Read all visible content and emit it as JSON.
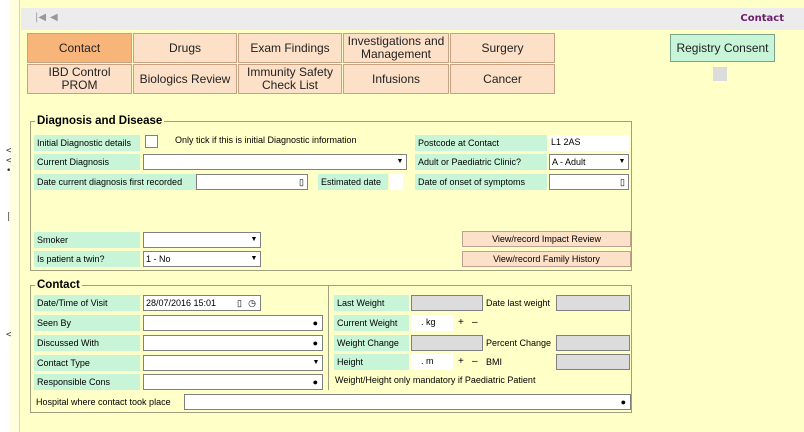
{
  "nav": {
    "first_icon": "first-record-icon",
    "prev_icon": "previous-record-icon"
  },
  "header": {
    "title": "Contact"
  },
  "tabs_row1": [
    "Contact",
    "Drugs",
    "Exam Findings",
    "Investigations and Management",
    "Surgery"
  ],
  "tabs_row2": [
    "IBD Control PROM",
    "Biologics Review",
    "Immunity Safety Check List",
    "Infusions",
    "Cancer"
  ],
  "registry_button": "Registry Consent",
  "side_marks": [
    "<",
    "<",
    ">",
    "•",
    "<"
  ],
  "diagnosis": {
    "title": "Diagnosis and Disease",
    "initial_label": "Initial Diagnostic details",
    "initial_note": "Only tick if this is initial Diagnostic information",
    "postcode_label": "Postcode at Contact",
    "postcode_value": "L1 2AS",
    "current_diag_label": "Current Diagnosis",
    "current_diag_value": "",
    "clinic_label": "Adult or Paediatric Clinic?",
    "clinic_value": "A - Adult",
    "date_first_label": "Date current diagnosis first recorded",
    "date_first_value": "",
    "estimated_label": "Estimated date",
    "onset_label": "Date of onset of symptoms",
    "onset_value": "",
    "smoker_label": "Smoker",
    "smoker_value": "",
    "twin_label": "Is patient a twin?",
    "twin_value": "1 - No",
    "impact_button": "View/record Impact Review",
    "family_button": "View/record Family History"
  },
  "contact": {
    "title": "Contact",
    "visit_label": "Date/Time of Visit",
    "visit_value": "28/07/2016 15:01",
    "seen_label": "Seen By",
    "seen_value": "",
    "discussed_label": "Discussed With",
    "discussed_value": "",
    "type_label": "Contact Type",
    "type_value": "",
    "cons_label": "Responsible Cons",
    "cons_value": "",
    "hospital_label": "Hospital where contact took place",
    "hospital_value": "",
    "last_weight_label": "Last Weight",
    "date_last_weight_label": "Date last weight",
    "current_weight_label": "Current Weight",
    "current_weight_value": ". kg",
    "plus": "+",
    "minus": "–",
    "weight_change_label": "Weight Change",
    "percent_change_label": "Percent Change",
    "height_label": "Height",
    "height_value": ". m",
    "bmi_label": "BMI",
    "mandatory_note": "Weight/Height only mandatory if Paediatric Patient"
  }
}
